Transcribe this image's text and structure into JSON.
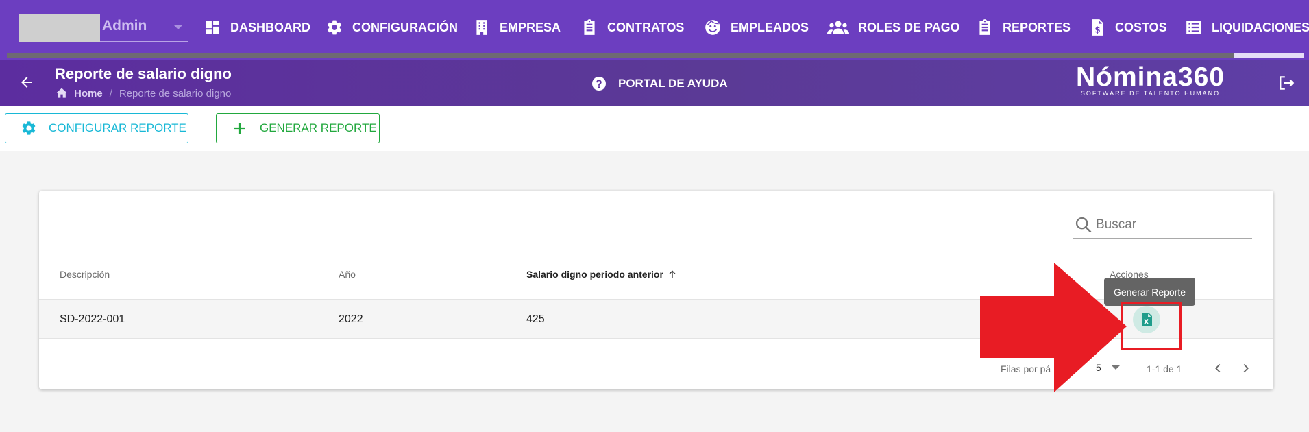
{
  "nav": {
    "profile": {
      "name": "Admin"
    },
    "items": [
      {
        "label": "DASHBOARD",
        "icon": "dashboard-icon"
      },
      {
        "label": "CONFIGURACIÓN",
        "icon": "gear-icon"
      },
      {
        "label": "EMPRESA",
        "icon": "building-icon"
      },
      {
        "label": "CONTRATOS",
        "icon": "clipboard-icon"
      },
      {
        "label": "EMPLEADOS",
        "icon": "face-icon"
      },
      {
        "label": "ROLES DE PAGO",
        "icon": "users-icon"
      },
      {
        "label": "REPORTES",
        "icon": "clipboard-icon"
      },
      {
        "label": "COSTOS",
        "icon": "invoice-dollar-icon"
      },
      {
        "label": "LIQUIDACIONES",
        "icon": "list-icon"
      }
    ]
  },
  "subheader": {
    "title": "Reporte de salario digno",
    "breadcrumb": {
      "home": "Home",
      "separator": "/",
      "current": "Reporte de salario digno"
    },
    "help_label": "PORTAL DE AYUDA",
    "brand_name": "Nómina360",
    "brand_tagline": "SOFTWARE DE TALENTO HUMANO"
  },
  "toolbar": {
    "configure_label": "CONFIGURAR REPORTE",
    "generate_label": "GENERAR REPORTE"
  },
  "table": {
    "search_placeholder": "Buscar",
    "columns": [
      "Descripción",
      "Año",
      "Salario digno periodo anterior",
      "Acciones"
    ],
    "sorted_column": "Salario digno periodo anterior",
    "rows": [
      {
        "descripcion": "SD-2022-001",
        "anio": "2022",
        "salario": "425"
      }
    ],
    "action_tooltip": "Generar Reporte",
    "footer": {
      "rows_per_page_label": "Filas por pá",
      "rows_per_page": "5",
      "range": "1-1 de 1"
    }
  },
  "colors": {
    "nav_bg": "#6c3ec0",
    "subheader_bg": "#5c2d9f",
    "configure_accent": "#18b8d6",
    "generate_accent": "#22a83e",
    "excel_green": "#1f9d8b",
    "annotation_red": "#e81c24"
  }
}
